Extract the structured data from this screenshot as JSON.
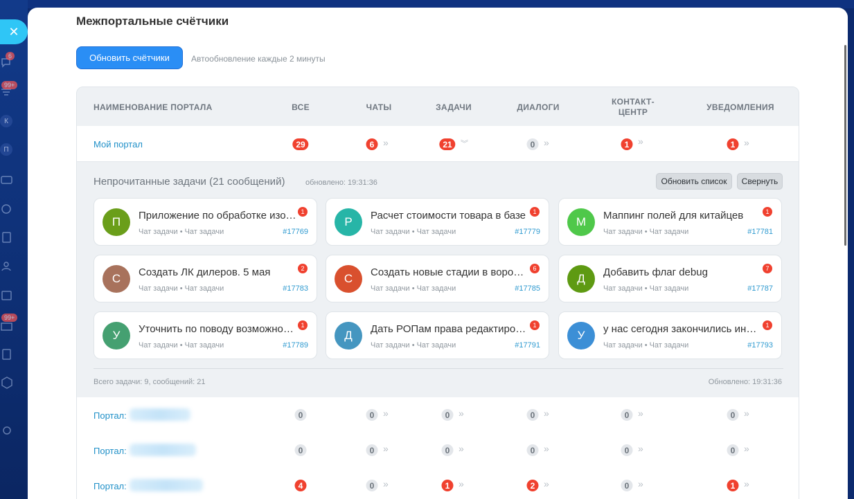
{
  "sidebar": {
    "close_icon": "close-icon",
    "badges": [
      "6",
      "99+",
      "99+"
    ],
    "letters": [
      "К",
      "П"
    ]
  },
  "page": {
    "title": "Межпортальные счётчики",
    "refresh_button": "Обновить счётчики",
    "autoupdate": "Автообновление каждые 2 минуты"
  },
  "table": {
    "headers": [
      "Наименование портала",
      "Все",
      "Чаты",
      "Задачи",
      "Диалоги",
      "Контакт-центр",
      "Уведомления"
    ],
    "header_contact_line1": "Контакт-",
    "header_contact_line2": "центр",
    "main_row": {
      "name": "Мой портал",
      "all": "29",
      "chats": "6",
      "tasks": "21",
      "dialogs": "0",
      "contact": "1",
      "notifications": "1"
    },
    "portal_rows": [
      {
        "label": "Портал:",
        "all": "0",
        "chats": "0",
        "tasks": "0",
        "dialogs": "0",
        "contact": "0",
        "notifications": "0"
      },
      {
        "label": "Портал:",
        "all": "0",
        "chats": "0",
        "tasks": "0",
        "dialogs": "0",
        "contact": "0",
        "notifications": "0"
      },
      {
        "label": "Портал:",
        "all": "4",
        "chats": "0",
        "tasks": "1",
        "dialogs": "2",
        "contact": "0",
        "notifications": "1"
      }
    ]
  },
  "expanded": {
    "title": "Непрочитанные задачи (21 сообщений)",
    "updated": "обновлено: 19:31:36",
    "refresh_list": "Обновить список",
    "collapse": "Свернуть",
    "cards": [
      {
        "initial": "П",
        "color": "#6a9e1a",
        "title": "Приложение по обработке изображений",
        "sub": "Чат задачи  • Чат задачи",
        "id": "#17769",
        "badge": "1"
      },
      {
        "initial": "Р",
        "color": "#27b5a7",
        "title": "Расчет стоимости товара в базе",
        "sub": "Чат задачи  • Чат задачи",
        "id": "#17779",
        "badge": "1"
      },
      {
        "initial": "М",
        "color": "#4fc84a",
        "title": "Маппинг полей для китайцев",
        "sub": "Чат задачи  • Чат задачи",
        "id": "#17781",
        "badge": "1"
      },
      {
        "initial": "С",
        "color": "#a8725c",
        "title": "Создать ЛК дилеров. 5 мая",
        "sub": "Чат задачи  • Чат задачи",
        "id": "#17783",
        "badge": "2"
      },
      {
        "initial": "С",
        "color": "#d9502e",
        "title": "Создать новые стадии в воронке",
        "sub": "Чат задачи  • Чат задачи",
        "id": "#17785",
        "badge": "6"
      },
      {
        "initial": "Д",
        "color": "#5e9a12",
        "title": "Добавить флаг debug",
        "sub": "Чат задачи  • Чат задачи",
        "id": "#17787",
        "badge": "7"
      },
      {
        "initial": "У",
        "color": "#45a071",
        "title": "Уточнить по поводу возможности",
        "sub": "Чат задачи  • Чат задачи",
        "id": "#17789",
        "badge": "1"
      },
      {
        "initial": "Д",
        "color": "#4596c0",
        "title": "Дать РОПам права редактирования",
        "sub": "Чат задачи  • Чат задачи",
        "id": "#17791",
        "badge": "1"
      },
      {
        "initial": "У",
        "color": "#3c8fd6",
        "title": "у нас сегодня закончились интеграции",
        "sub": "Чат задачи  • Чат задачи",
        "id": "#17793",
        "badge": "1"
      }
    ],
    "total": "Всего задачи: 9, сообщений: 21",
    "updated_footer": "Обновлено: 19:31:36"
  },
  "colors": {
    "accent": "#2a8ef5",
    "counter_red": "#f0412f",
    "link": "#2090c8"
  }
}
